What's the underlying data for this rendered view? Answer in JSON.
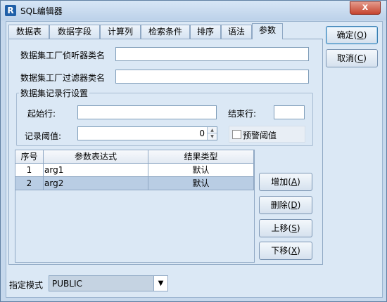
{
  "window": {
    "app_icon_letter": "R",
    "title": "SQL编辑器",
    "close_glyph": "x"
  },
  "tabs": [
    {
      "label": "数据表",
      "active": false
    },
    {
      "label": "数据字段",
      "active": false
    },
    {
      "label": "计算列",
      "active": false
    },
    {
      "label": "检索条件",
      "active": false
    },
    {
      "label": "排序",
      "active": false
    },
    {
      "label": "语法",
      "active": false
    },
    {
      "label": "参数",
      "active": true
    }
  ],
  "params": {
    "listener_label": "数据集工厂侦听器类名",
    "listener_value": "",
    "filter_label": "数据集工厂过滤器类名",
    "filter_value": "",
    "record_group_title": "数据集记录行设置",
    "start_row_label": "起始行:",
    "start_row_value": "",
    "end_row_label": "结束行:",
    "end_row_value": "",
    "threshold_label": "记录阈值:",
    "threshold_value": "0",
    "warn_threshold_label": "预警阈值",
    "warn_threshold_checked": false
  },
  "table": {
    "columns": [
      "序号",
      "参数表达式",
      "结果类型"
    ],
    "rows": [
      {
        "index": "1",
        "expression": "arg1",
        "type": "默认",
        "selected": false
      },
      {
        "index": "2",
        "expression": "arg2",
        "type": "默认",
        "selected": true
      }
    ]
  },
  "side_buttons": [
    {
      "label": "增加",
      "key": "A"
    },
    {
      "label": "删除",
      "key": "D"
    },
    {
      "label": "上移",
      "key": "S"
    },
    {
      "label": "下移",
      "key": "X"
    }
  ],
  "dialog_buttons": {
    "ok_label": "确定",
    "ok_key": "O",
    "cancel_label": "取消",
    "cancel_key": "C"
  },
  "mode": {
    "label": "指定模式",
    "value": "PUBLIC"
  },
  "colors": {
    "background": "#dbe8f5",
    "selected_row": "#b9cde4",
    "close_button": "#c6442f"
  }
}
